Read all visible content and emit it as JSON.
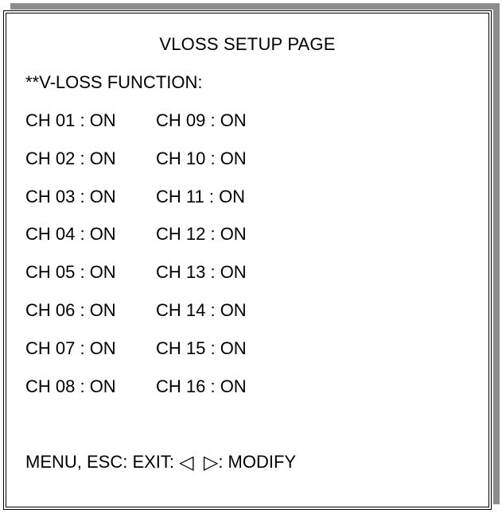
{
  "page": {
    "title": "VLOSS SETUP PAGE",
    "function_label": "**V-LOSS FUNCTION:"
  },
  "channels": [
    {
      "left": "CH 01 : ON",
      "right": "CH 09 : ON"
    },
    {
      "left": "CH 02 : ON",
      "right": "CH 10 : ON"
    },
    {
      "left": "CH 03 : ON",
      "right": "CH 11 : ON"
    },
    {
      "left": "CH 04 : ON",
      "right": "CH 12 : ON"
    },
    {
      "left": "CH 05 : ON",
      "right": "CH 13 : ON"
    },
    {
      "left": "CH 06 : ON",
      "right": "CH 14 : ON"
    },
    {
      "left": "CH 07 : ON",
      "right": "CH 15 : ON"
    },
    {
      "left": "CH 08 : ON",
      "right": "CH 16 : ON"
    }
  ],
  "footer": {
    "exit_text": "MENU, ESC: EXIT: ",
    "left_arrow": "◁",
    "right_arrow": "▷",
    "modify_text": ": MODIFY"
  }
}
